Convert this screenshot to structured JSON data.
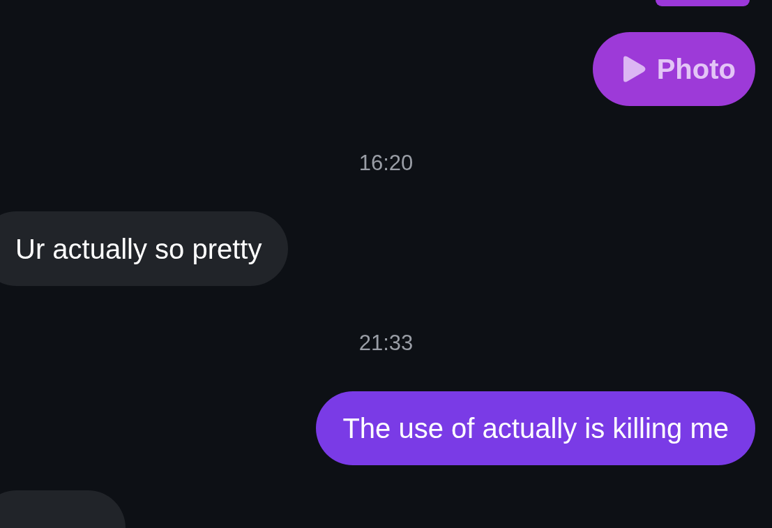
{
  "messages": [
    {
      "kind": "partial",
      "outgoing": true
    },
    {
      "kind": "photo",
      "outgoing": true,
      "label": "Photo"
    },
    {
      "kind": "timestamp",
      "text": "16:20"
    },
    {
      "kind": "text",
      "outgoing": false,
      "text": "Ur actually so pretty"
    },
    {
      "kind": "timestamp",
      "text": "21:33"
    },
    {
      "kind": "text",
      "outgoing": true,
      "text": "The use of actually is killing me"
    },
    {
      "kind": "partial",
      "outgoing": false
    }
  ]
}
